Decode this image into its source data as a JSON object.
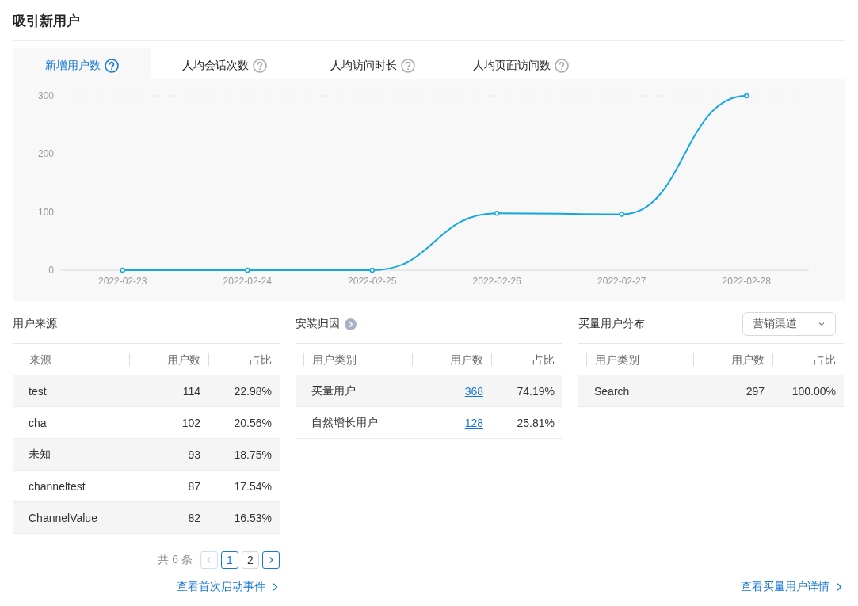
{
  "title": "吸引新用户",
  "tabs": [
    {
      "label": "新增用户数",
      "selected": true
    },
    {
      "label": "人均会话次数",
      "selected": false
    },
    {
      "label": "人均访问时长",
      "selected": false
    },
    {
      "label": "人均页面访问数",
      "selected": false
    }
  ],
  "chart_data": {
    "type": "line",
    "categories": [
      "2022-02-23",
      "2022-02-24",
      "2022-02-25",
      "2022-02-26",
      "2022-02-27",
      "2022-02-28"
    ],
    "series": [
      {
        "color": "#16a6e0",
        "marker": true,
        "values": [
          0,
          0,
          0,
          98,
          96,
          300
        ]
      }
    ],
    "ylim": [
      0,
      300
    ],
    "yticks": [
      0,
      100,
      200,
      300
    ]
  },
  "panels": [
    {
      "title": "用户来源",
      "columns": [
        "来源",
        "用户数",
        "占比"
      ],
      "users_linked": false,
      "rows": [
        {
          "name": "test",
          "users": "114",
          "share": "22.98%"
        },
        {
          "name": "cha",
          "users": "102",
          "share": "20.56%"
        },
        {
          "name": "未知",
          "users": "93",
          "share": "18.75%"
        },
        {
          "name": "channeltest",
          "users": "87",
          "share": "17.54%"
        },
        {
          "name": "ChannelValue",
          "users": "82",
          "share": "16.53%"
        }
      ],
      "pagination": {
        "total": "共 6 条",
        "prev_disabled": true,
        "next_disabled": false,
        "pages": [
          {
            "label": "1",
            "selected": true
          },
          {
            "label": "2",
            "selected": false
          }
        ]
      },
      "link": "查看首次启动事件"
    },
    {
      "title": "安装归因",
      "has_info": true,
      "columns": [
        "用户类别",
        "用户数",
        "占比"
      ],
      "users_linked": true,
      "rows": [
        {
          "name": "买量用户",
          "users": "368",
          "share": "74.19%"
        },
        {
          "name": "自然增长用户",
          "users": "128",
          "share": "25.81%"
        }
      ]
    },
    {
      "title": "买量用户分布",
      "dropdown": "营销渠道",
      "columns": [
        "用户类别",
        "用户数",
        "占比"
      ],
      "users_linked": false,
      "rows": [
        {
          "name": "Search",
          "users": "297",
          "share": "100.00%"
        }
      ],
      "link": "查看买量用户详情"
    }
  ]
}
